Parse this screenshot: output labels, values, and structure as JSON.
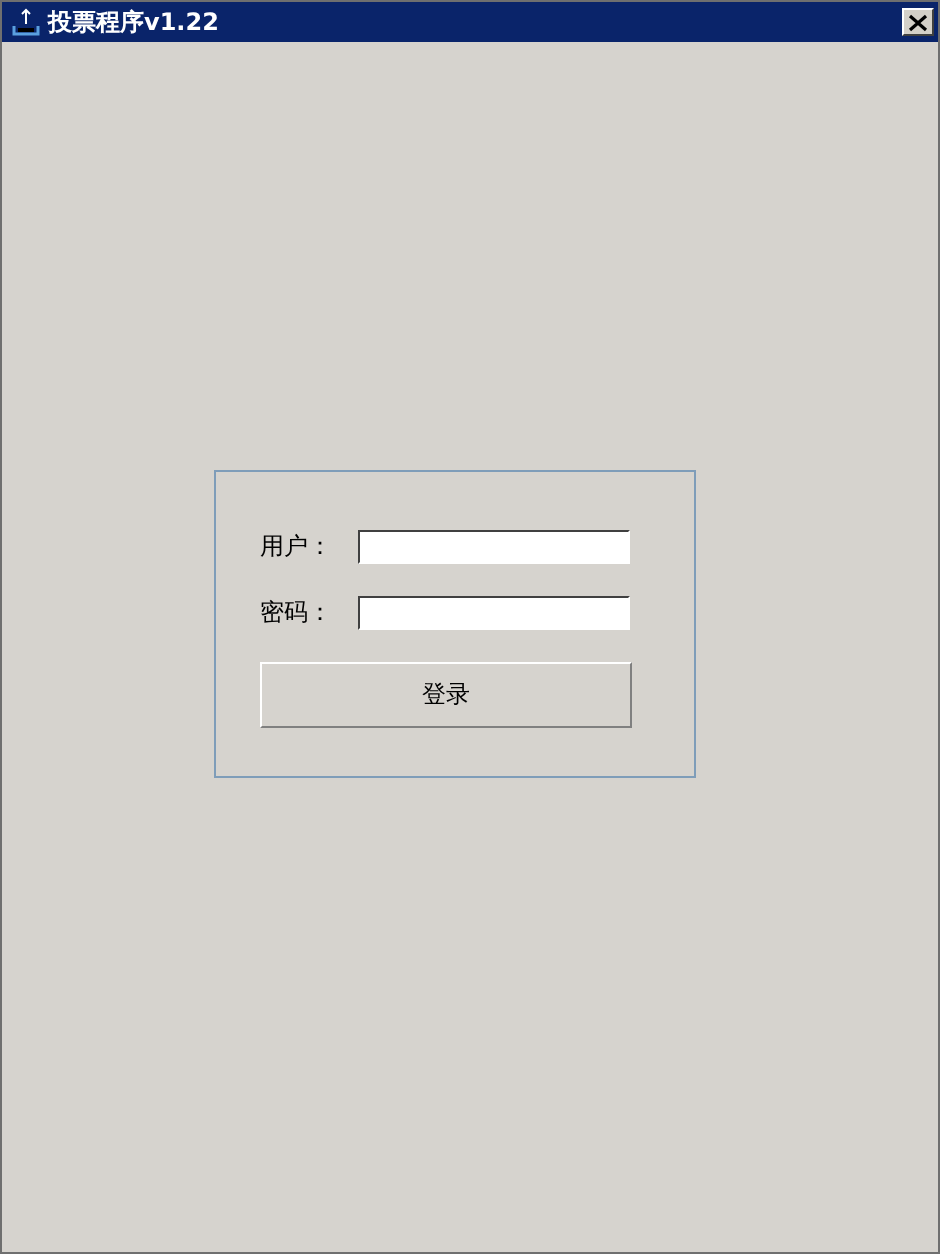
{
  "window": {
    "title": "投票程序v1.22"
  },
  "form": {
    "fields": [
      {
        "label": "用户："
      },
      {
        "label": "密码："
      }
    ],
    "button": "登录"
  }
}
